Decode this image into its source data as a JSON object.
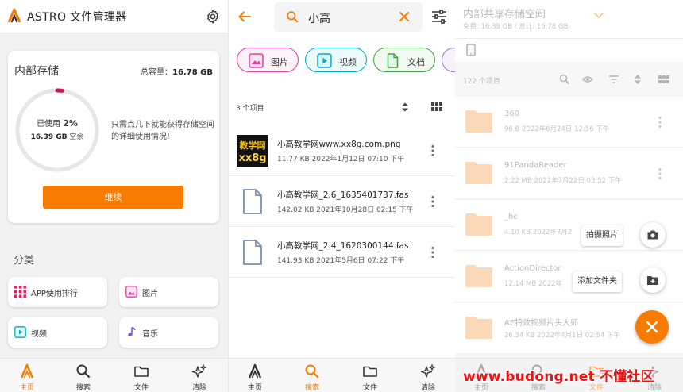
{
  "left_panel": {
    "app_title": "ASTRO 文件管理器",
    "storage_card": {
      "title": "内部存储",
      "total_label": "总容量：",
      "total_value": "16.78 GB",
      "used_label": "已使用",
      "used_percent": "2%",
      "free_value": "16.39 GB",
      "free_label": "空余",
      "used_fraction": 0.02,
      "hint": "只需点几下就能获得存储空间的详细使用情况!",
      "continue_button": "继续"
    },
    "categories_title": "分类",
    "categories": [
      {
        "label": "APP使用排行",
        "icon": "apps-grid-icon"
      },
      {
        "label": "图片",
        "icon": "image-icon"
      },
      {
        "label": "视频",
        "icon": "video-icon"
      },
      {
        "label": "音乐",
        "icon": "music-note-icon"
      }
    ]
  },
  "bottom_nav": {
    "home": "主页",
    "search": "搜索",
    "files": "文件",
    "clean": "清除"
  },
  "search_panel": {
    "query": "小高",
    "chips": [
      "图片",
      "视频",
      "文档"
    ],
    "result_count": "3 个项目",
    "files": [
      {
        "name": "小高教学网www.xx8g.com.png",
        "meta": "11.77 KB 2022年1月12日 07:10 下午",
        "thumb_text_1": "教学网",
        "thumb_text_2": "xx8g"
      },
      {
        "name": "小高教学网_2.6_1635401737.fas",
        "meta": "142.02 KB 2021年10月28日 02:15 下午"
      },
      {
        "name": "小高教学网_2.4_1620300144.fas",
        "meta": "141.93 KB 2021年5月6日 07:22 下午"
      }
    ]
  },
  "files_panel": {
    "title": "内部共享存储空间",
    "subtitle": "免费: 16.39 GB / 总计: 16.78 GB",
    "item_count": "122 个项目",
    "folders": [
      {
        "name": "360",
        "meta": "96 B 2022年6月24日 12:56 下午"
      },
      {
        "name": "91PandaReader",
        "meta": "2.22 MB 2022年7月22日 03:52 下午"
      },
      {
        "name": "_hc",
        "meta": "4.10 KB 2022年7月2"
      },
      {
        "name": "ActionDirector",
        "meta": "12.14 MB 2022年"
      },
      {
        "name": "AE特效视频片头大师",
        "meta": "26.34 KB 2022年4月1日 02:54 下午"
      }
    ],
    "fab_take_photo": "拍摄照片",
    "fab_add_folder": "添加文件夹",
    "watermark": "www.budong.net 不懂社区"
  },
  "colors": {
    "accent": "#f57c00",
    "ring_track": "#e6e6e6",
    "ring_used": "#c2185b",
    "chip_image": "#e040a0",
    "chip_video": "#00acc1",
    "chip_doc": "#43a047"
  }
}
